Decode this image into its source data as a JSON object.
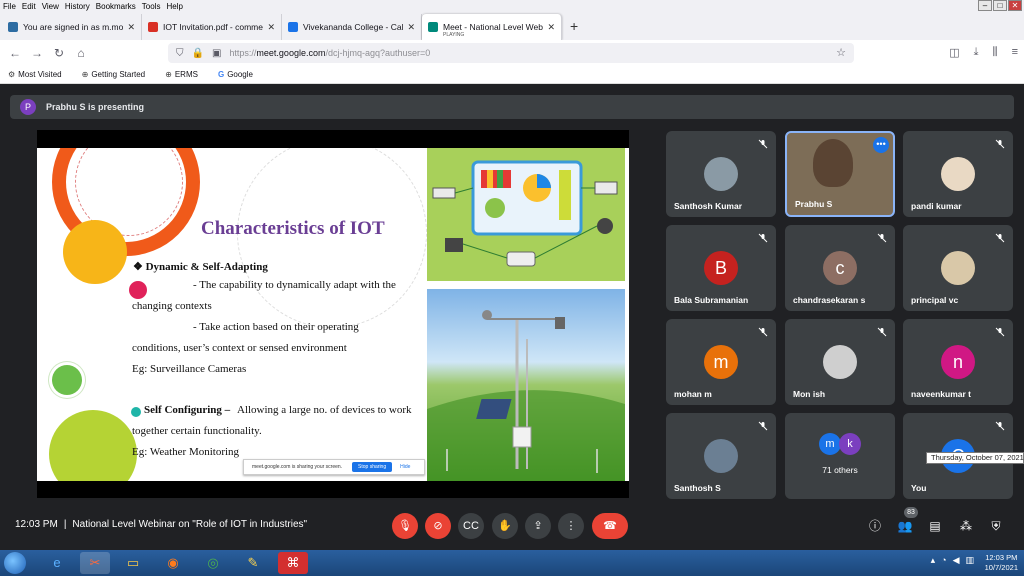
{
  "browser": {
    "menu": [
      "File",
      "Edit",
      "View",
      "History",
      "Bookmarks",
      "Tools",
      "Help"
    ],
    "tabs": [
      {
        "title": "You are signed in as m.mohan",
        "color": "#2d6ca2"
      },
      {
        "title": "IOT Invitation.pdf - commerce",
        "color": "#d93025"
      },
      {
        "title": "Vivekananda College - Calenda",
        "color": "#1a73e8"
      },
      {
        "title": "Meet - National Level Webinar",
        "subtitle": "PLAYING",
        "color": "#00897b"
      }
    ],
    "url": {
      "prefix": "https://",
      "host": "meet.google.com",
      "path": "/dcj-hjmq-agq?authuser=0"
    },
    "bookmarks": [
      "Most Visited",
      "Getting Started",
      "ERMS",
      "Google"
    ]
  },
  "meet": {
    "presenting": {
      "initial": "P",
      "text": "Prabhu S is presenting"
    },
    "slide": {
      "title": "Characteristics of IOT",
      "lines": [
        "❖ Dynamic & Self-Adapting",
        "- The capability to dynamically adapt with the",
        "changing contexts",
        "- Take action based  on their operating",
        "conditions, user’s context or sensed environment",
        "Eg: Surveillance Cameras",
        "Self Configuring –",
        "Allowing a large no. of devices to work",
        "together certain functionality.",
        "Eg: Weather Monitoring"
      ],
      "sharebar": {
        "text": "meet.google.com is sharing your screen.",
        "stop": "Stop sharing",
        "hide": "Hide"
      }
    },
    "participants": [
      {
        "name": "Santhosh Kumar",
        "initial": "",
        "color": "#8a9aa5"
      },
      {
        "name": "Prabhu S",
        "initial": "",
        "color": ""
      },
      {
        "name": "pandi kumar",
        "initial": "",
        "color": "#e9d9c4"
      },
      {
        "name": "Bala Subramanian",
        "initial": "B",
        "color": "#c5221f"
      },
      {
        "name": "chandrasekaran s",
        "initial": "c",
        "color": "#8d6e63"
      },
      {
        "name": "principal vc",
        "initial": "",
        "color": "#d9c8a8"
      },
      {
        "name": "mohan m",
        "initial": "m",
        "color": "#e8710a"
      },
      {
        "name": "Mon ish",
        "initial": "",
        "color": "#cfcfcf"
      },
      {
        "name": "naveenkumar t",
        "initial": "n",
        "color": "#d01884"
      },
      {
        "name": "Santhosh S",
        "initial": "",
        "color": "#6b7f93"
      },
      {
        "name": "You",
        "initial": "C",
        "color": "#1a73e8"
      }
    ],
    "others": {
      "label": "71 others",
      "a": "m",
      "b": "k"
    },
    "time": "12:03 PM",
    "meeting_title": "National Level Webinar on \"Role of IOT in Industries\"",
    "participant_count": "83",
    "tooltip": "Thursday, October 07, 2021"
  },
  "taskbar": {
    "time": "12:03 PM",
    "date": "10/7/2021"
  }
}
